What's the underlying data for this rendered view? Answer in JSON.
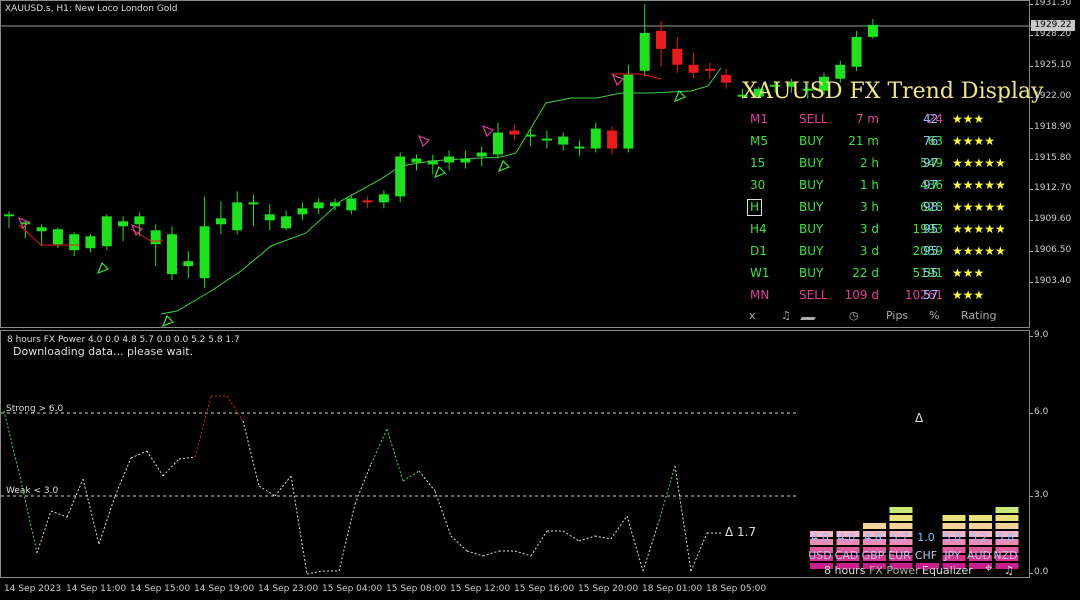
{
  "chart_header": "XAUUSD.s, H1:  New Loco London Gold",
  "current_price": "1929.22",
  "price_axis": [
    "1931.30",
    "1928.20",
    "1925.10",
    "1922.00",
    "1918.90",
    "1915.80",
    "1912.70",
    "1909.60",
    "1906.50",
    "1903.40"
  ],
  "time_axis": [
    "14 Sep 2023",
    "14 Sep 11:00",
    "14 Sep 15:00",
    "14 Sep 19:00",
    "14 Sep 23:00",
    "15 Sep 04:00",
    "15 Sep 08:00",
    "15 Sep 12:00",
    "15 Sep 16:00",
    "15 Sep 20:00",
    "18 Sep 01:00",
    "18 Sep 05:00"
  ],
  "trend_display": {
    "title": "XAUUSD FX Trend Display",
    "rows": [
      {
        "tf": "M1",
        "signal": "SELL",
        "time": "7 m",
        "pips": "24",
        "pct": "42",
        "stars": "★★★",
        "color": "#e0409a",
        "selected": false
      },
      {
        "tf": "M5",
        "signal": "BUY",
        "time": "21 m",
        "pips": "63",
        "pct": "76",
        "stars": "★★★★",
        "color": "#3ee03e",
        "selected": false
      },
      {
        "tf": "15",
        "signal": "BUY",
        "time": "2 h",
        "pips": "549",
        "pct": "97",
        "stars": "★★★★★",
        "color": "#3ee03e",
        "selected": false
      },
      {
        "tf": "30",
        "signal": "BUY",
        "time": "1 h",
        "pips": "436",
        "pct": "97",
        "stars": "★★★★★",
        "color": "#3ee03e",
        "selected": false
      },
      {
        "tf": "H",
        "signal": "BUY",
        "time": "3 h",
        "pips": "628",
        "pct": "98",
        "stars": "★★★★★",
        "color": "#3ee03e",
        "selected": true
      },
      {
        "tf": "H4",
        "signal": "BUY",
        "time": "3 d",
        "pips": "1993",
        "pct": "95",
        "stars": "★★★★★",
        "color": "#3ee03e",
        "selected": false
      },
      {
        "tf": "D1",
        "signal": "BUY",
        "time": "3 d",
        "pips": "2059",
        "pct": "95",
        "stars": "★★★★★",
        "color": "#3ee03e",
        "selected": false
      },
      {
        "tf": "W1",
        "signal": "BUY",
        "time": "22 d",
        "pips": "5191",
        "pct": "55",
        "stars": "★★★",
        "color": "#3ee03e",
        "selected": false
      },
      {
        "tf": "MN",
        "signal": "SELL",
        "time": "109 d",
        "pips": "10261",
        "pct": "57",
        "stars": "★★★",
        "color": "#e0409a",
        "selected": false
      }
    ],
    "footer": {
      "close": "x",
      "sound": "♫",
      "clock": "◷",
      "pips": "Pips",
      "pct": "%",
      "rating": "Rating"
    }
  },
  "power": {
    "header": "8 hours FX Power 4.0 0.0 4.8 5.7 0.0 0.0 5.2 5.8 1.7",
    "status": "Downloading data... please wait.",
    "strong_label": "Strong > 6.0",
    "weak_label": "Weak < 3.0",
    "delta_marker": "Δ",
    "delta_value": "Δ 1.7",
    "axis": [
      "9.0",
      "6.0",
      "3.0",
      "0.0"
    ],
    "equalizer": {
      "values": [
        "4.0",
        "4.0",
        "4.8",
        "5.7",
        "1.0",
        "5.0",
        "5.2",
        "5.8"
      ],
      "currencies": [
        "USD",
        "CAD",
        "GBP",
        "EUR",
        "CHF",
        "JPY",
        "AUD",
        "NZD"
      ],
      "levels": [
        4.0,
        4.0,
        4.8,
        5.7,
        1.0,
        5.0,
        5.2,
        5.8
      ]
    },
    "footer": {
      "period": "8 hours",
      "name": "FX Power",
      "mode": "Equalizer",
      "crosshair": "⌖",
      "sound": "♫"
    }
  },
  "colors": {
    "bull": "#1fe01f",
    "bear": "#e81c1c",
    "ma": "#3fd03f",
    "sell": "#e0409a",
    "buy": "#3ee03e",
    "title": "#f0e68c",
    "stars": "#ffff40"
  }
}
